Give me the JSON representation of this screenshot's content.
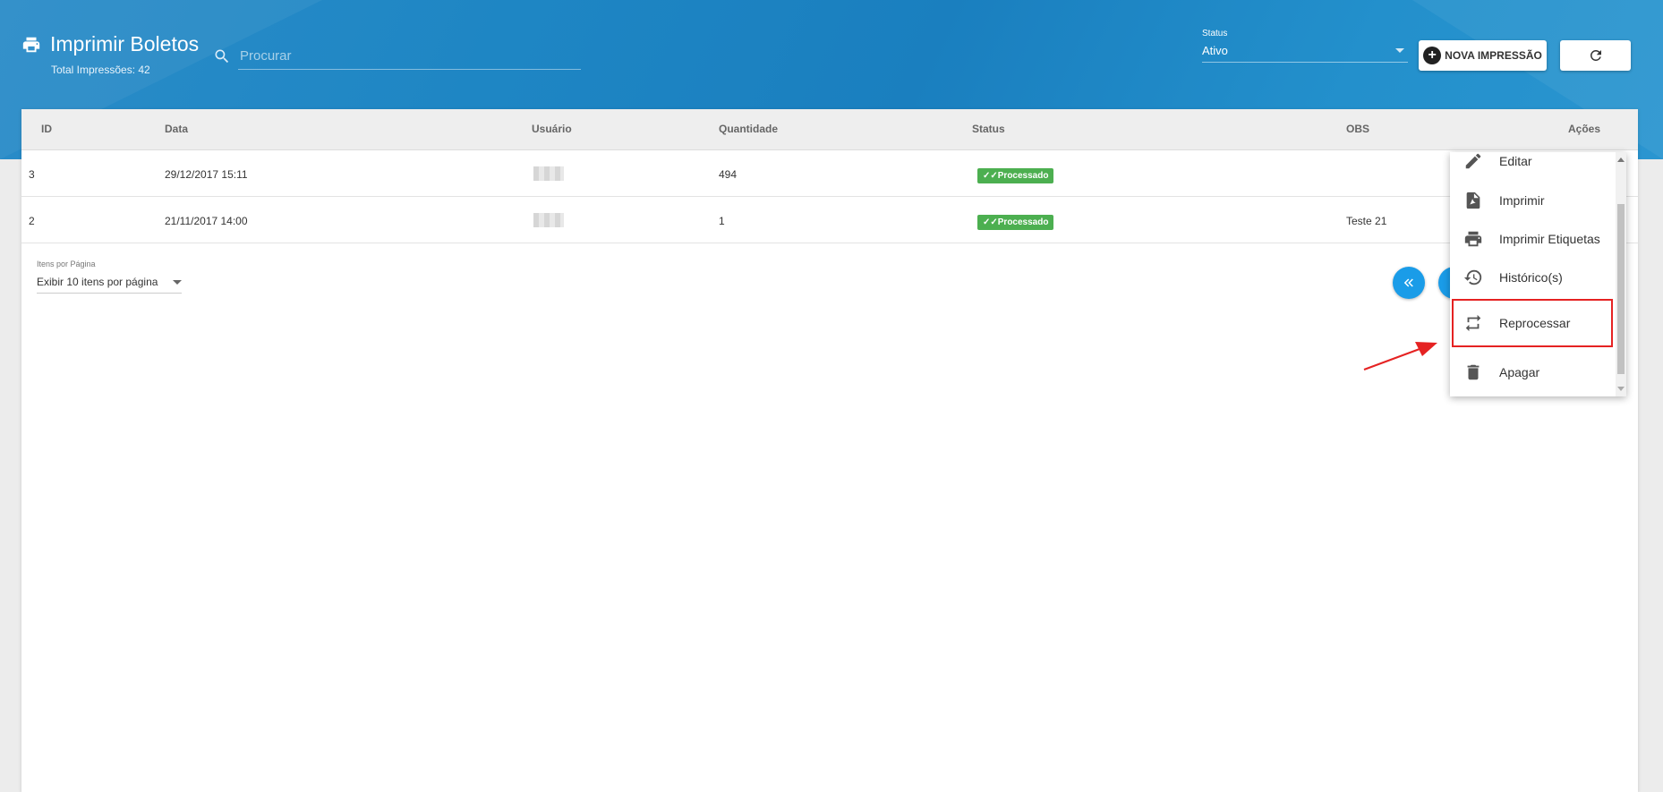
{
  "header": {
    "title": "Imprimir Boletos",
    "subtitle": "Total Impressões: 42",
    "search_placeholder": "Procurar",
    "status_label": "Status",
    "status_value": "Ativo",
    "new_button": "NOVA IMPRESSÃO"
  },
  "table": {
    "columns": [
      "ID",
      "Data",
      "Usuário",
      "Quantidade",
      "Status",
      "OBS",
      "Ações"
    ],
    "rows": [
      {
        "id": "3",
        "data": "29/12/2017 15:11",
        "quantidade": "494",
        "status": "Processado",
        "obs": ""
      },
      {
        "id": "2",
        "data": "21/11/2017 14:00",
        "quantidade": "1",
        "status": "Processado",
        "obs": "Teste 21"
      }
    ]
  },
  "pagination": {
    "per_page_label": "Itens por Página",
    "per_page_value": "Exibir 10 itens por página"
  },
  "menu": {
    "items": [
      "Editar",
      "Imprimir",
      "Imprimir Etiquetas",
      "Histórico(s)",
      "Reprocessar",
      "Apagar"
    ],
    "highlighted": "Reprocessar"
  },
  "colors": {
    "header_blue": "#1e86c4",
    "status_green": "#4caf50",
    "pagination_blue": "#1a9ce8",
    "annotation_red": "#e52222"
  }
}
